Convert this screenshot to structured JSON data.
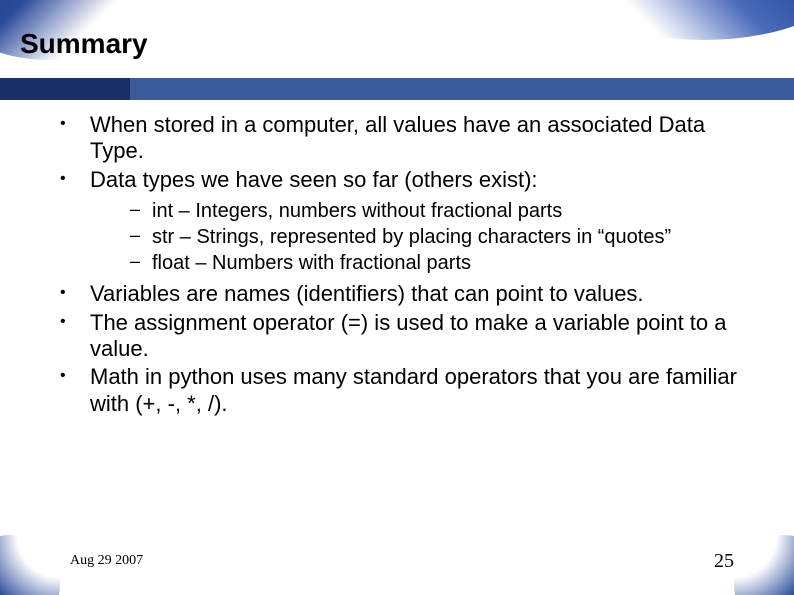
{
  "title": "Summary",
  "bullets": [
    {
      "text": "When stored in a computer, all values have an associated Data Type."
    },
    {
      "text": "Data types we have seen so far (others exist):",
      "sub": [
        "int – Integers, numbers without fractional parts",
        "str – Strings, represented by placing characters in “quotes”",
        "float – Numbers with fractional parts"
      ]
    },
    {
      "text": "Variables are names (identifiers) that can point to values."
    },
    {
      "text": "The assignment operator (=) is used to make a variable point to a value."
    },
    {
      "text": "Math in python uses many standard operators that you are familiar with (+, -, *, /)."
    }
  ],
  "footer": {
    "date": "Aug 29 2007",
    "page": "25"
  }
}
